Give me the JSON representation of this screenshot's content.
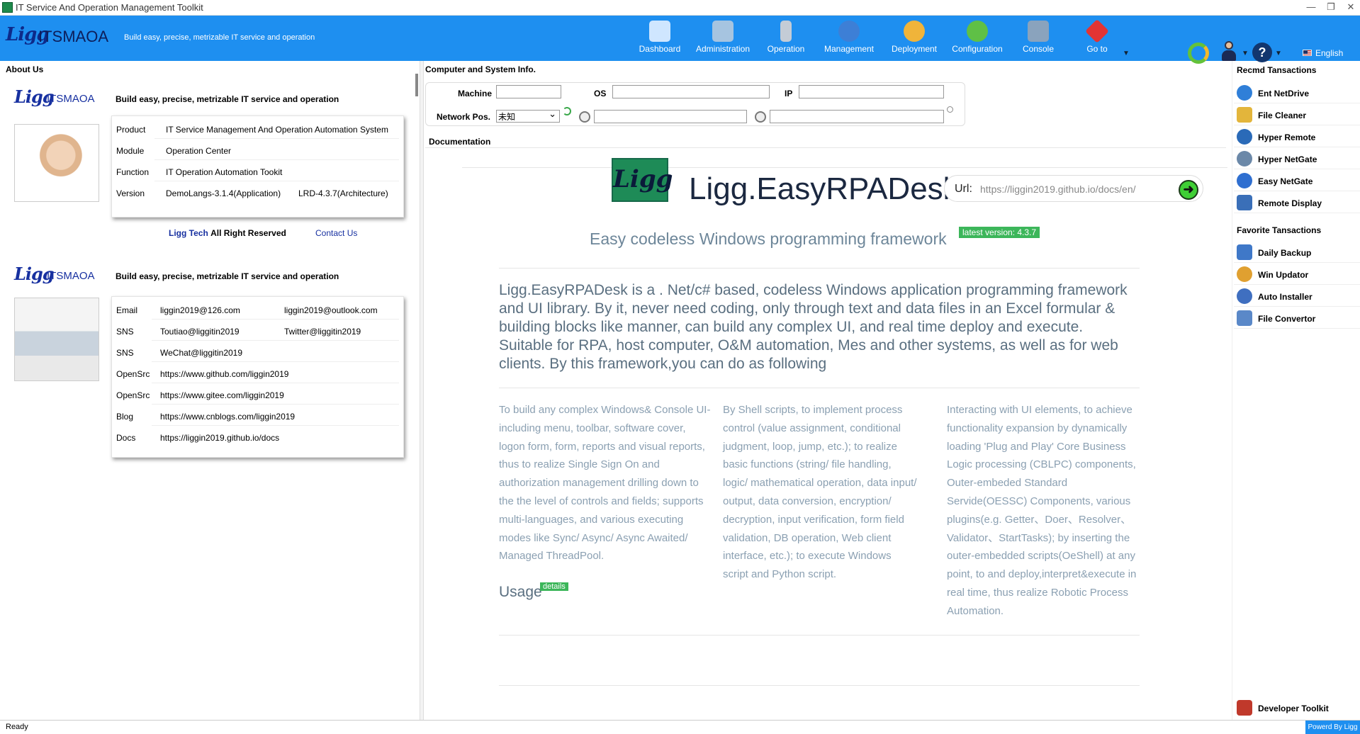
{
  "window": {
    "title": "IT Service And Operation Management Toolkit"
  },
  "header": {
    "logo": "Ligg",
    "brand": "ITSMAOA",
    "tagline": "Build easy, precise, metrizable IT service and operation",
    "nav": [
      {
        "label": "Dashboard",
        "icon": "house-icon"
      },
      {
        "label": "Administration",
        "icon": "monitors-icon"
      },
      {
        "label": "Operation",
        "icon": "server-icon"
      },
      {
        "label": "Management",
        "icon": "globe-icon"
      },
      {
        "label": "Deployment",
        "icon": "deploy-icon"
      },
      {
        "label": "Configuration",
        "icon": "gear-icon"
      },
      {
        "label": "Console",
        "icon": "console-icon"
      },
      {
        "label": "Go to",
        "icon": "goto-icon"
      }
    ],
    "language": "English"
  },
  "about": {
    "section_title": "About Us",
    "card1": {
      "logo": "Ligg",
      "brand": "ITSMAOA",
      "tagline": "Build easy, precise, metrizable IT service and operation",
      "rows": [
        {
          "label": "Product",
          "value": "IT Service Management And Operation Automation System"
        },
        {
          "label": "Module",
          "value": "Operation Center"
        },
        {
          "label": "Function",
          "value": "IT Operation Automation Tookit"
        },
        {
          "label": "Version",
          "value": "DemoLangs-3.1.4(Application)",
          "value2": "LRD-4.3.7(Architecture)"
        }
      ]
    },
    "copyright_company": "Ligg Tech",
    "copyright_text": "All Right Reserved",
    "contact_label": "Contact Us",
    "card2": {
      "logo": "Ligg",
      "brand": "ITSMAOA",
      "tagline": "Build easy, precise, metrizable IT service and operation",
      "rows": [
        {
          "label": "Email",
          "value": "liggin2019@126.com",
          "value2": "liggin2019@outlook.com"
        },
        {
          "label": "SNS",
          "value": "Toutiao@liggitin2019",
          "value2": "Twitter@liggitin2019"
        },
        {
          "label": "SNS",
          "value": "WeChat@liggitin2019"
        },
        {
          "label": "OpenSrc",
          "value": "https://www.github.com/liggin2019"
        },
        {
          "label": "OpenSrc",
          "value": "https://www.gitee.com/liggin2019"
        },
        {
          "label": "Blog",
          "value": "https://www.cnblogs.com/liggin2019"
        },
        {
          "label": "Docs",
          "value": "https://liggin2019.github.io/docs"
        }
      ]
    }
  },
  "sysinfo": {
    "section_title": "Computer and System Info.",
    "machine_label": "Machine",
    "os_label": "OS",
    "ip_label": "IP",
    "netpos_label": "Network Pos.",
    "netpos_value": "未知",
    "machine_value": "",
    "os_value": "",
    "ip_value": ""
  },
  "docs": {
    "section_title": "Documentation",
    "logo_text": "Ligg",
    "title": "Ligg.EasyRPADesk",
    "url_label": "Url:",
    "url_value": "https://liggin2019.github.io/docs/en/",
    "subtitle": "Easy codeless Windows programming framework",
    "version_badge": "latest version: 4.3.7",
    "intro": "Ligg.EasyRPADesk is a . Net/c# based, codeless Windows application programming framework and UI library. By it, never need coding, only through text and data files in an Excel formular & building blocks like manner, can build any complex UI, and real time deploy and execute. Suitable for RPA, host computer, O&M automation, Mes and other systems, as well as for web clients. By this framework,you can do as following",
    "col1": "To build any complex Windows& Console UI-including menu, toolbar, software cover, logon form, form, reports and visual reports, thus to realize Single Sign On and authorization management drilling down to the the level of controls and fields; supports multi-languages, and various executing modes like Sync/ Async/ Async Awaited/ Managed ThreadPool.",
    "col2": "By Shell scripts, to implement process control (value assignment, conditional judgment, loop, jump, etc.); to realize basic functions (string/ file handling, logic/ mathematical operation, data input/ output, data conversion, encryption/ decryption, input verification, form field validation, DB operation, Web client interface, etc.); to execute Windows script and Python script.",
    "col3": "Interacting with UI elements, to achieve functionality expansion by dynamically loading 'Plug and Play' Core Business Logic processing (CBLPC) components, Outer-embeded Standard Servide(OESSC) Components, various plugins(e.g. Getter、Doer、Resolver、Validator、StartTasks); by inserting the outer-embedded scripts(OeShell) at any point, to and deploy,interpret&execute in real time, thus realize Robotic Process Automation.",
    "usage": "Usage",
    "usage_badge": "details"
  },
  "right": {
    "recmd_title": "Recmd Tansactions",
    "recmd": [
      {
        "label": "Ent NetDrive",
        "icon": "globe-icon",
        "color": "#2f7fd8"
      },
      {
        "label": "File Cleaner",
        "icon": "broom-icon",
        "color": "#e3b53b"
      },
      {
        "label": "Hyper Remote",
        "icon": "remote-icon",
        "color": "#2a6ab8"
      },
      {
        "label": "Hyper NetGate",
        "icon": "netgate-icon",
        "color": "#6b88a8"
      },
      {
        "label": "Easy NetGate",
        "icon": "info-icon",
        "color": "#2f6fd0"
      },
      {
        "label": "Remote Display",
        "icon": "display-icon",
        "color": "#3a6fb8"
      }
    ],
    "favorite_title": "Favorite Tansactions",
    "favorite": [
      {
        "label": "Daily Backup",
        "icon": "backup-icon",
        "color": "#3f78c8"
      },
      {
        "label": "Win Updator",
        "icon": "updator-icon",
        "color": "#e0a030"
      },
      {
        "label": "Auto Installer",
        "icon": "installer-icon",
        "color": "#3f6fc0"
      },
      {
        "label": "File Convertor",
        "icon": "convertor-icon",
        "color": "#5a88c8"
      }
    ],
    "developer": {
      "label": "Developer Toolkit",
      "icon": "tools-icon",
      "color": "#c0392b"
    }
  },
  "status": {
    "text": "Ready",
    "powered": "Powerd By Ligg"
  }
}
